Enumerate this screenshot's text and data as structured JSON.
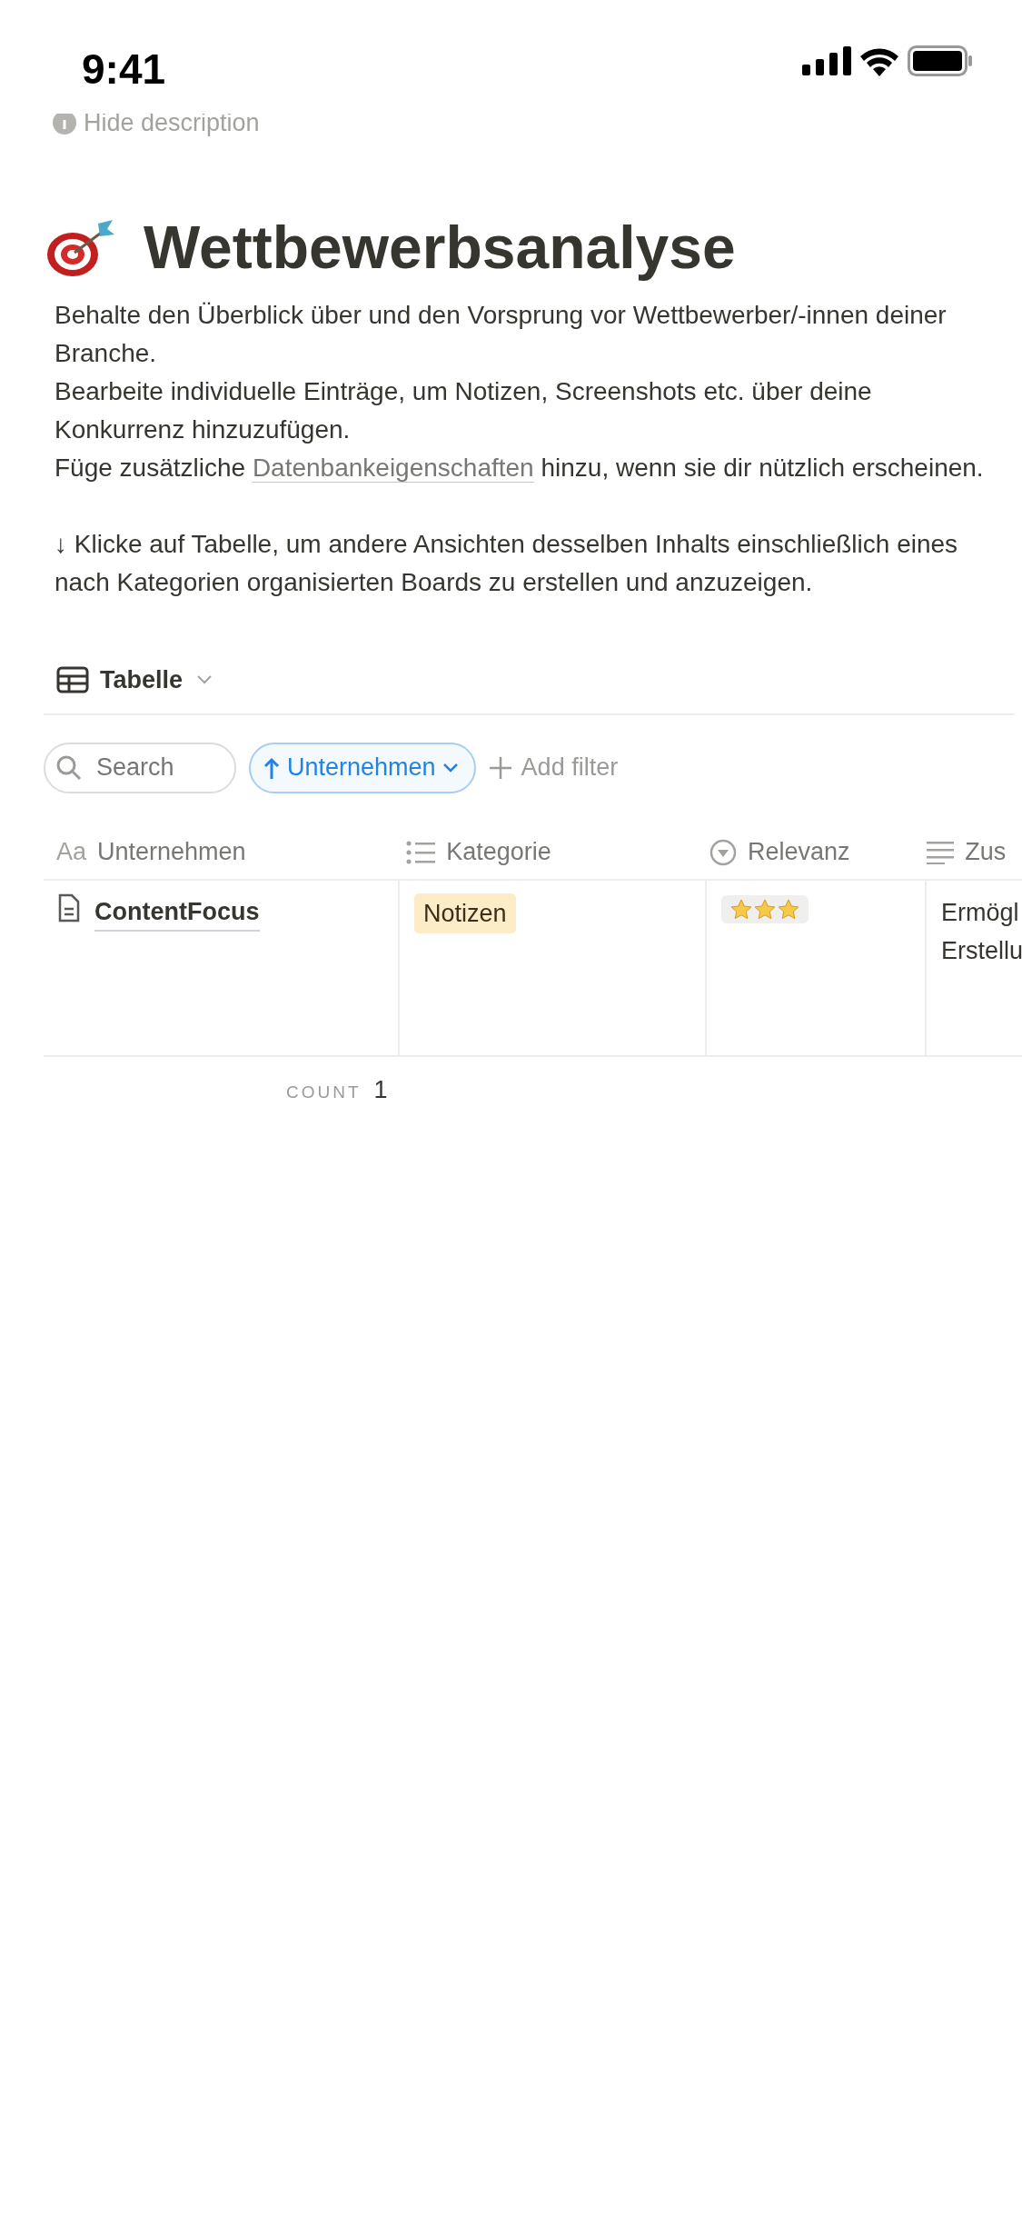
{
  "status_bar": {
    "time": "9:41"
  },
  "hide_description": "Hide description",
  "title": "Wettbewerbsanalyse",
  "description": [
    "Behalte den Überblick über und den Vorsprung vor Wettbewerber/-innen deiner Branche.",
    "Bearbeite individuelle Einträge, um Notizen, Screenshots etc. über deine Konkurrenz hinzuzufügen.",
    {
      "before": "Füge zusätzliche ",
      "link": "Datenbankeigenschaften",
      "after": " hinzu, wenn sie dir nützlich erscheinen."
    }
  ],
  "hint": "↓ Klicke auf Tabelle, um andere Ansichten desselben Inhalts einschließlich eines nach Kategorien organisierten Boards zu erstellen und anzuzeigen.",
  "view": {
    "label": "Tabelle"
  },
  "toolbar": {
    "search_placeholder": "Search",
    "sort": "Unternehmen",
    "add_filter": "Add filter"
  },
  "table": {
    "columns": [
      {
        "kind": "title",
        "icon_text": "Aa",
        "label": "Unternehmen"
      },
      {
        "kind": "list",
        "label": "Kategorie"
      },
      {
        "kind": "select",
        "label": "Relevanz"
      },
      {
        "kind": "text",
        "label": "Zus"
      }
    ],
    "rows": [
      {
        "name": "ContentFocus",
        "tag": "Notizen",
        "color": "#fdecc8",
        "stars": 3,
        "text_lines": [
          "Ermögl",
          "Erstellu"
        ]
      }
    ]
  },
  "footer": {
    "count_label": "COUNT",
    "count": "1"
  }
}
